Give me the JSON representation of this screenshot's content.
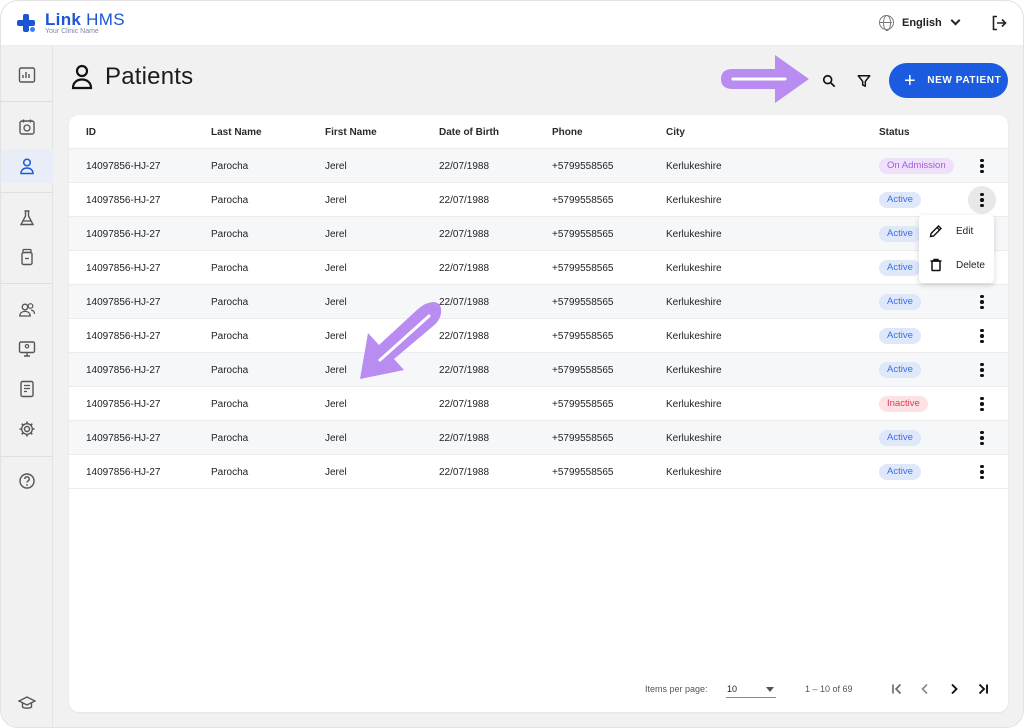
{
  "brand": {
    "name_bold": "Link",
    "name_rest": " HMS",
    "subtitle": "Your Clinic Name"
  },
  "header": {
    "language": "English"
  },
  "sidebar": {
    "items": [
      {
        "icon": "dashboard-icon"
      },
      {
        "icon": "appointments-icon"
      },
      {
        "icon": "patients-icon",
        "active": true
      },
      {
        "icon": "lab-icon"
      },
      {
        "icon": "pharmacy-icon"
      },
      {
        "icon": "staff-icon"
      },
      {
        "icon": "monitor-icon"
      },
      {
        "icon": "reports-icon"
      },
      {
        "icon": "settings-icon"
      },
      {
        "icon": "help-icon"
      },
      {
        "icon": "academy-icon"
      }
    ]
  },
  "page": {
    "title": "Patients",
    "new_button": "NEW PATIENT"
  },
  "table": {
    "columns": [
      "ID",
      "Last Name",
      "First Name",
      "Date of Birth",
      "Phone",
      "City",
      "Status"
    ],
    "rows": [
      {
        "id": "14097856-HJ-27",
        "last": "Parocha",
        "first": "Jerel",
        "dob": "22/07/1988",
        "phone": "+5799558565",
        "city": "Kerlukeshire",
        "status": "On Admission"
      },
      {
        "id": "14097856-HJ-27",
        "last": "Parocha",
        "first": "Jerel",
        "dob": "22/07/1988",
        "phone": "+5799558565",
        "city": "Kerlukeshire",
        "status": "Active"
      },
      {
        "id": "14097856-HJ-27",
        "last": "Parocha",
        "first": "Jerel",
        "dob": "22/07/1988",
        "phone": "+5799558565",
        "city": "Kerlukeshire",
        "status": "Active"
      },
      {
        "id": "14097856-HJ-27",
        "last": "Parocha",
        "first": "Jerel",
        "dob": "22/07/1988",
        "phone": "+5799558565",
        "city": "Kerlukeshire",
        "status": "Active"
      },
      {
        "id": "14097856-HJ-27",
        "last": "Parocha",
        "first": "Jerel",
        "dob": "22/07/1988",
        "phone": "+5799558565",
        "city": "Kerlukeshire",
        "status": "Active"
      },
      {
        "id": "14097856-HJ-27",
        "last": "Parocha",
        "first": "Jerel",
        "dob": "22/07/1988",
        "phone": "+5799558565",
        "city": "Kerlukeshire",
        "status": "Active"
      },
      {
        "id": "14097856-HJ-27",
        "last": "Parocha",
        "first": "Jerel",
        "dob": "22/07/1988",
        "phone": "+5799558565",
        "city": "Kerlukeshire",
        "status": "Active"
      },
      {
        "id": "14097856-HJ-27",
        "last": "Parocha",
        "first": "Jerel",
        "dob": "22/07/1988",
        "phone": "+5799558565",
        "city": "Kerlukeshire",
        "status": "Inactive"
      },
      {
        "id": "14097856-HJ-27",
        "last": "Parocha",
        "first": "Jerel",
        "dob": "22/07/1988",
        "phone": "+5799558565",
        "city": "Kerlukeshire",
        "status": "Active"
      },
      {
        "id": "14097856-HJ-27",
        "last": "Parocha",
        "first": "Jerel",
        "dob": "22/07/1988",
        "phone": "+5799558565",
        "city": "Kerlukeshire",
        "status": "Active"
      }
    ]
  },
  "context_menu": {
    "edit": "Edit",
    "delete": "Delete"
  },
  "pager": {
    "items_label": "Items per page:",
    "page_size": "10",
    "range": "1 – 10 of 69"
  },
  "colors": {
    "primary": "#1a5be0",
    "annotation_arrow": "#b98cf2"
  }
}
